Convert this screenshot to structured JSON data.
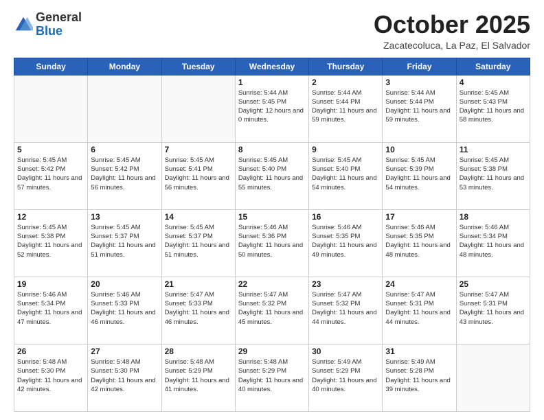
{
  "header": {
    "logo_line1": "General",
    "logo_line2": "Blue",
    "month_title": "October 2025",
    "subtitle": "Zacatecoluca, La Paz, El Salvador"
  },
  "weekdays": [
    "Sunday",
    "Monday",
    "Tuesday",
    "Wednesday",
    "Thursday",
    "Friday",
    "Saturday"
  ],
  "weeks": [
    [
      {
        "day": "",
        "sunrise": "",
        "sunset": "",
        "daylight": "",
        "empty": true
      },
      {
        "day": "",
        "sunrise": "",
        "sunset": "",
        "daylight": "",
        "empty": true
      },
      {
        "day": "",
        "sunrise": "",
        "sunset": "",
        "daylight": "",
        "empty": true
      },
      {
        "day": "1",
        "sunrise": "Sunrise: 5:44 AM",
        "sunset": "Sunset: 5:45 PM",
        "daylight": "Daylight: 12 hours and 0 minutes."
      },
      {
        "day": "2",
        "sunrise": "Sunrise: 5:44 AM",
        "sunset": "Sunset: 5:44 PM",
        "daylight": "Daylight: 11 hours and 59 minutes."
      },
      {
        "day": "3",
        "sunrise": "Sunrise: 5:44 AM",
        "sunset": "Sunset: 5:44 PM",
        "daylight": "Daylight: 11 hours and 59 minutes."
      },
      {
        "day": "4",
        "sunrise": "Sunrise: 5:45 AM",
        "sunset": "Sunset: 5:43 PM",
        "daylight": "Daylight: 11 hours and 58 minutes."
      }
    ],
    [
      {
        "day": "5",
        "sunrise": "Sunrise: 5:45 AM",
        "sunset": "Sunset: 5:42 PM",
        "daylight": "Daylight: 11 hours and 57 minutes."
      },
      {
        "day": "6",
        "sunrise": "Sunrise: 5:45 AM",
        "sunset": "Sunset: 5:42 PM",
        "daylight": "Daylight: 11 hours and 56 minutes."
      },
      {
        "day": "7",
        "sunrise": "Sunrise: 5:45 AM",
        "sunset": "Sunset: 5:41 PM",
        "daylight": "Daylight: 11 hours and 56 minutes."
      },
      {
        "day": "8",
        "sunrise": "Sunrise: 5:45 AM",
        "sunset": "Sunset: 5:40 PM",
        "daylight": "Daylight: 11 hours and 55 minutes."
      },
      {
        "day": "9",
        "sunrise": "Sunrise: 5:45 AM",
        "sunset": "Sunset: 5:40 PM",
        "daylight": "Daylight: 11 hours and 54 minutes."
      },
      {
        "day": "10",
        "sunrise": "Sunrise: 5:45 AM",
        "sunset": "Sunset: 5:39 PM",
        "daylight": "Daylight: 11 hours and 54 minutes."
      },
      {
        "day": "11",
        "sunrise": "Sunrise: 5:45 AM",
        "sunset": "Sunset: 5:38 PM",
        "daylight": "Daylight: 11 hours and 53 minutes."
      }
    ],
    [
      {
        "day": "12",
        "sunrise": "Sunrise: 5:45 AM",
        "sunset": "Sunset: 5:38 PM",
        "daylight": "Daylight: 11 hours and 52 minutes."
      },
      {
        "day": "13",
        "sunrise": "Sunrise: 5:45 AM",
        "sunset": "Sunset: 5:37 PM",
        "daylight": "Daylight: 11 hours and 51 minutes."
      },
      {
        "day": "14",
        "sunrise": "Sunrise: 5:45 AM",
        "sunset": "Sunset: 5:37 PM",
        "daylight": "Daylight: 11 hours and 51 minutes."
      },
      {
        "day": "15",
        "sunrise": "Sunrise: 5:46 AM",
        "sunset": "Sunset: 5:36 PM",
        "daylight": "Daylight: 11 hours and 50 minutes."
      },
      {
        "day": "16",
        "sunrise": "Sunrise: 5:46 AM",
        "sunset": "Sunset: 5:35 PM",
        "daylight": "Daylight: 11 hours and 49 minutes."
      },
      {
        "day": "17",
        "sunrise": "Sunrise: 5:46 AM",
        "sunset": "Sunset: 5:35 PM",
        "daylight": "Daylight: 11 hours and 48 minutes."
      },
      {
        "day": "18",
        "sunrise": "Sunrise: 5:46 AM",
        "sunset": "Sunset: 5:34 PM",
        "daylight": "Daylight: 11 hours and 48 minutes."
      }
    ],
    [
      {
        "day": "19",
        "sunrise": "Sunrise: 5:46 AM",
        "sunset": "Sunset: 5:34 PM",
        "daylight": "Daylight: 11 hours and 47 minutes."
      },
      {
        "day": "20",
        "sunrise": "Sunrise: 5:46 AM",
        "sunset": "Sunset: 5:33 PM",
        "daylight": "Daylight: 11 hours and 46 minutes."
      },
      {
        "day": "21",
        "sunrise": "Sunrise: 5:47 AM",
        "sunset": "Sunset: 5:33 PM",
        "daylight": "Daylight: 11 hours and 46 minutes."
      },
      {
        "day": "22",
        "sunrise": "Sunrise: 5:47 AM",
        "sunset": "Sunset: 5:32 PM",
        "daylight": "Daylight: 11 hours and 45 minutes."
      },
      {
        "day": "23",
        "sunrise": "Sunrise: 5:47 AM",
        "sunset": "Sunset: 5:32 PM",
        "daylight": "Daylight: 11 hours and 44 minutes."
      },
      {
        "day": "24",
        "sunrise": "Sunrise: 5:47 AM",
        "sunset": "Sunset: 5:31 PM",
        "daylight": "Daylight: 11 hours and 44 minutes."
      },
      {
        "day": "25",
        "sunrise": "Sunrise: 5:47 AM",
        "sunset": "Sunset: 5:31 PM",
        "daylight": "Daylight: 11 hours and 43 minutes."
      }
    ],
    [
      {
        "day": "26",
        "sunrise": "Sunrise: 5:48 AM",
        "sunset": "Sunset: 5:30 PM",
        "daylight": "Daylight: 11 hours and 42 minutes."
      },
      {
        "day": "27",
        "sunrise": "Sunrise: 5:48 AM",
        "sunset": "Sunset: 5:30 PM",
        "daylight": "Daylight: 11 hours and 42 minutes."
      },
      {
        "day": "28",
        "sunrise": "Sunrise: 5:48 AM",
        "sunset": "Sunset: 5:29 PM",
        "daylight": "Daylight: 11 hours and 41 minutes."
      },
      {
        "day": "29",
        "sunrise": "Sunrise: 5:48 AM",
        "sunset": "Sunset: 5:29 PM",
        "daylight": "Daylight: 11 hours and 40 minutes."
      },
      {
        "day": "30",
        "sunrise": "Sunrise: 5:49 AM",
        "sunset": "Sunset: 5:29 PM",
        "daylight": "Daylight: 11 hours and 40 minutes."
      },
      {
        "day": "31",
        "sunrise": "Sunrise: 5:49 AM",
        "sunset": "Sunset: 5:28 PM",
        "daylight": "Daylight: 11 hours and 39 minutes."
      },
      {
        "day": "",
        "sunrise": "",
        "sunset": "",
        "daylight": "",
        "empty": true
      }
    ]
  ]
}
